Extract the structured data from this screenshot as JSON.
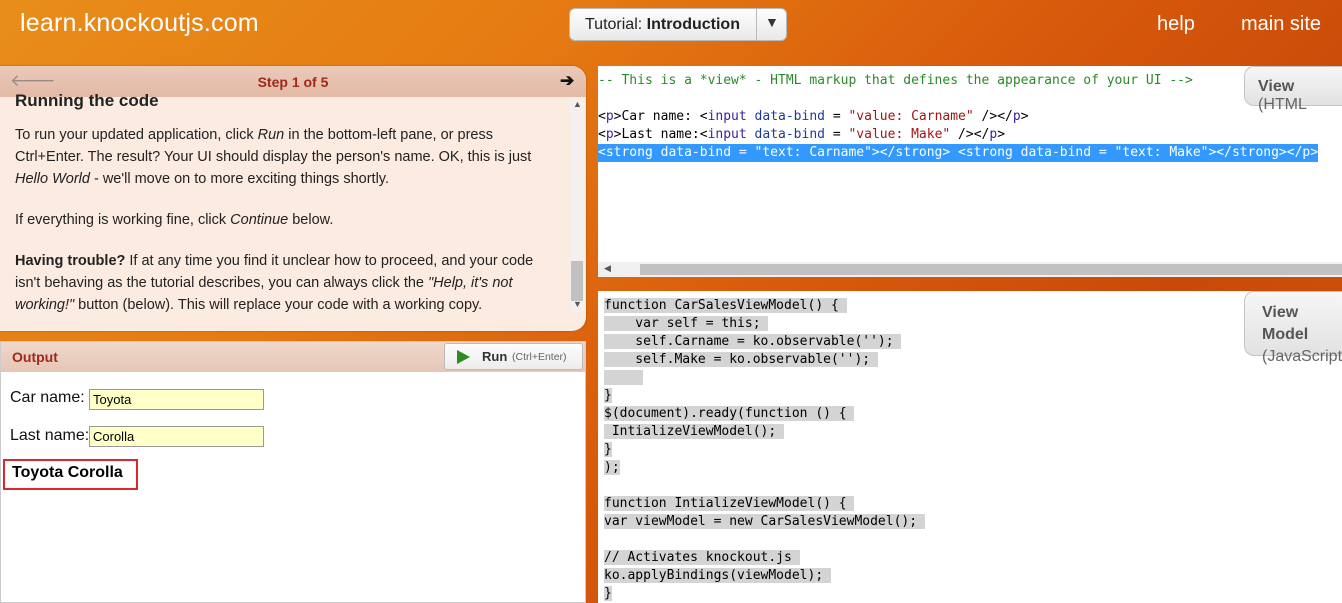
{
  "header": {
    "brand": "learn.knockoutjs.com",
    "tutorial_prefix": "Tutorial:",
    "tutorial_name": "Introduction",
    "nav": {
      "help": "help",
      "main_site": "main site"
    }
  },
  "instructions": {
    "step_label": "Step 1 of 5",
    "heading": "Running the code",
    "p1": [
      "To run your updated application, click ",
      "Run",
      " in the bottom-left pane, or press Ctrl+Enter. The result? Your UI should display the person's name. OK, this is just ",
      "Hello World",
      " - we'll move on to more exciting things shortly."
    ],
    "p2": [
      "If everything is working fine, click ",
      "Continue",
      " below."
    ],
    "p3": [
      "Having trouble?",
      " If at any time you find it unclear how to proceed, and your code isn't behaving as the tutorial describes, you can always click the ",
      "\"Help, it's not working!\"",
      " button (below). This will replace your code with a working copy."
    ]
  },
  "output": {
    "title": "Output",
    "run_label": "Run",
    "run_shortcut": "(Ctrl+Enter)",
    "car_label": "Car name:",
    "car_value": "Toyota",
    "last_label": "Last name:",
    "last_value": "Corolla",
    "result": "Toyota Corolla"
  },
  "view_editor": {
    "tab_title": "View",
    "tab_sub": "(HTML",
    "comment": "-- This is a *view* - HTML markup that defines the appearance of your UI -->",
    "line2": [
      "<",
      "p",
      ">Car name: <",
      "input",
      " ",
      "data-bind",
      " = ",
      "\"value: Carname\"",
      " /></",
      "p",
      ">"
    ],
    "line3": [
      "<",
      "p",
      ">Last name:<",
      "input",
      " ",
      "data-bind",
      " = ",
      "\"value: Make\"",
      " /></",
      "p",
      ">"
    ],
    "line4": "<strong data-bind = \"text: Carname\"></strong> <strong data-bind = \"text: Make\"></strong></p>"
  },
  "js_editor": {
    "tab_title": "View Model",
    "tab_sub": "(JavaScript",
    "lines": [
      "function CarSalesViewModel() { ",
      "    var self = this; ",
      "    self.Carname = ko.observable(''); ",
      "    self.Make = ko.observable(''); ",
      "     ",
      "}",
      "$(document).ready(function () { ",
      " IntializeViewModel(); ",
      "}",
      ");",
      "",
      "function IntializeViewModel() { ",
      "var viewModel = new CarSalesViewModel(); ",
      "",
      "// Activates knockout.js ",
      "ko.applyBindings(viewModel); ",
      "}"
    ]
  }
}
